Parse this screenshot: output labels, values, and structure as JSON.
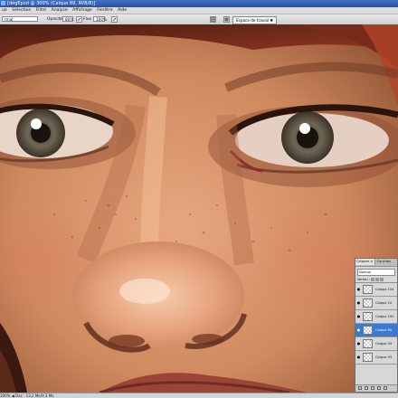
{
  "window": {
    "title": "[dégEpod @ 300% (Calque 89, RVB/8)]"
  },
  "menu": {
    "items": [
      "ue",
      "Sélection",
      "Filtre",
      "Analyse",
      "Affichage",
      "Fenêtre",
      "Aide"
    ]
  },
  "options_bar": {
    "mode_value": "rmal",
    "opacity_label": "Opacité :",
    "opacity_value": "80%",
    "flow_label": "Flux :",
    "flow_value": "100%",
    "workspace_label": "Espace de travail ▼"
  },
  "status_bar": {
    "zoom_and_doc": "300% ◀ Doc : 13,2 Mo/9,3 Mo"
  },
  "layers_panel": {
    "tabs": [
      "Calques ×",
      "Couches"
    ],
    "blend_mode": "Normal",
    "lock_label": "Verrou :",
    "layers": [
      {
        "name": "Calque 104",
        "selected": false
      },
      {
        "name": "Calque 10",
        "selected": false
      },
      {
        "name": "Calque 100",
        "selected": false
      },
      {
        "name": "Calque 89",
        "selected": true
      },
      {
        "name": "Calque 93",
        "selected": false
      },
      {
        "name": "Calque 93",
        "selected": false
      }
    ]
  },
  "colors": {
    "title_bar": "#2f62b8",
    "selected_layer": "#3b78cf",
    "skin": "#d9946b"
  },
  "icons": [
    "app-icon",
    "brush-icon",
    "airbrush-icon",
    "workspace-icon",
    "eye-icon",
    "lock-icon",
    "new-layer-icon",
    "trash-icon"
  ]
}
